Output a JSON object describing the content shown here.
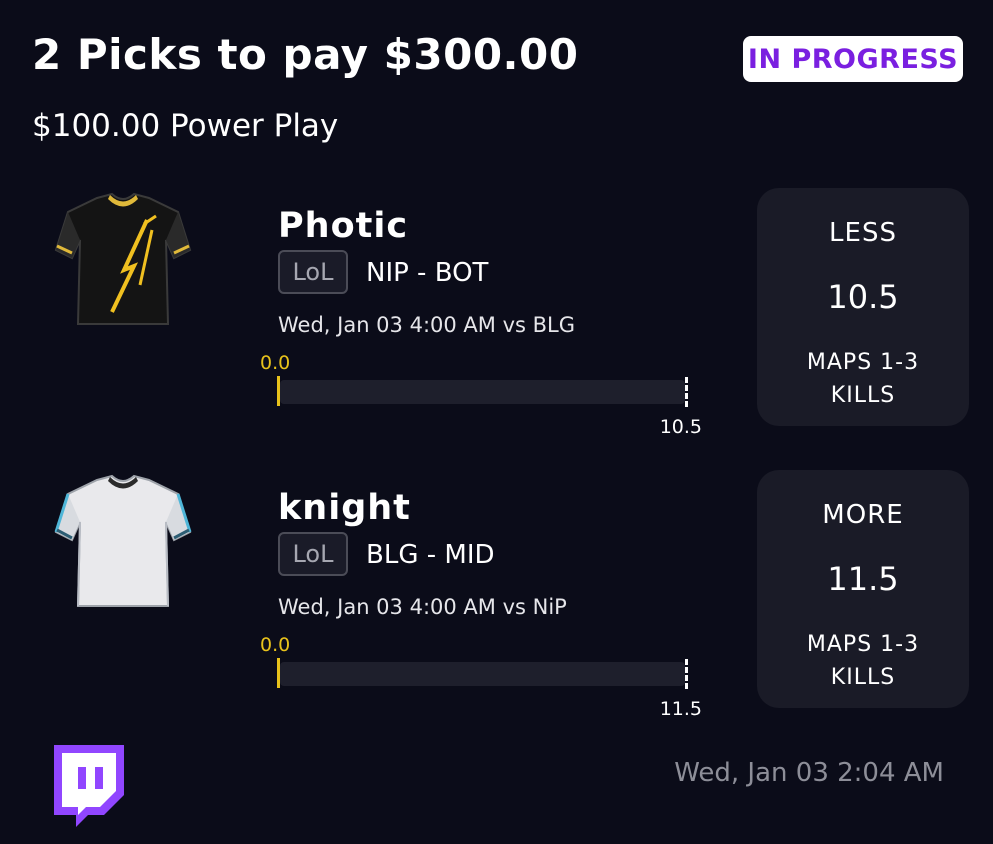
{
  "header": {
    "title": "2 Picks to pay $300.00",
    "status": "IN PROGRESS",
    "subtitle": "$100.00 Power Play"
  },
  "picks": [
    {
      "player": "Photic",
      "league": "LoL",
      "matchup": "NIP - BOT",
      "game_info": "Wed, Jan 03 4:00 AM  vs BLG",
      "current": "0.0",
      "line_label": "10.5",
      "progress_fraction": 0,
      "projection": {
        "direction": "LESS",
        "line": "10.5",
        "stat_line1": "MAPS 1-3",
        "stat_line2": "KILLS"
      },
      "jersey_icon": "black-gold-jersey-icon"
    },
    {
      "player": "knight",
      "league": "LoL",
      "matchup": "BLG - MID",
      "game_info": "Wed, Jan 03 4:00 AM  vs NiP",
      "current": "0.0",
      "line_label": "11.5",
      "progress_fraction": 0,
      "projection": {
        "direction": "MORE",
        "line": "11.5",
        "stat_line1": "MAPS 1-3",
        "stat_line2": "KILLS"
      },
      "jersey_icon": "white-blue-jersey-icon"
    }
  ],
  "footer": {
    "timestamp": "Wed, Jan 03 2:04 AM",
    "logo_icon": "twitch-icon"
  },
  "colors": {
    "background": "#0b0c19",
    "accent_purple": "#7a1fe0",
    "progress_yellow": "#e8c21b",
    "card": "#1a1b27",
    "twitch": "#9146ff"
  }
}
